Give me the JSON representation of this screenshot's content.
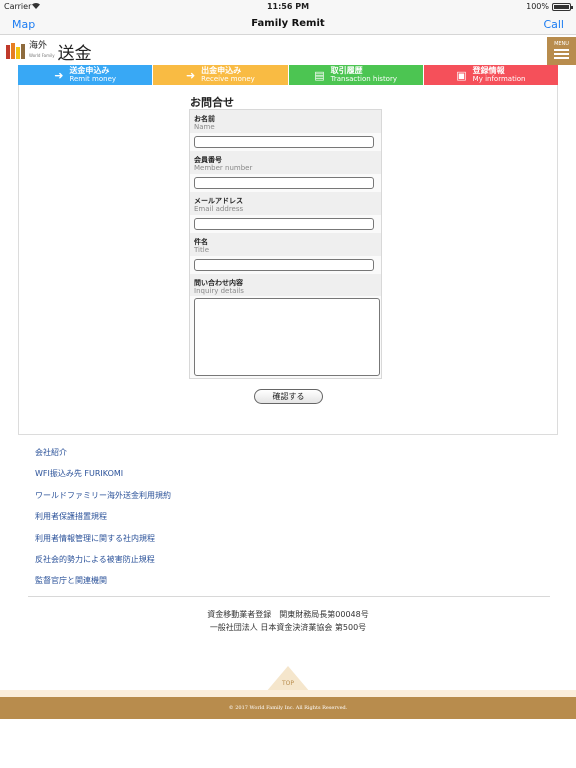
{
  "status_bar": {
    "carrier": "Carrier",
    "time": "11:56 PM",
    "battery": "100%",
    "battery_level": 1.0
  },
  "nav": {
    "left": "Map",
    "title": "Family Remit",
    "right": "Call"
  },
  "logo": {
    "small_jp": "海外",
    "small_en": "World Family",
    "big": "送金",
    "colors": [
      "#c0392b",
      "#e67e22",
      "#f1c40f",
      "#8e6b3d"
    ]
  },
  "menu_button": {
    "label": "MENU"
  },
  "tabs": [
    {
      "jp": "送金申込み",
      "en": "Remit money",
      "icon": "remit-icon",
      "glyph": "➜",
      "color": "#38a8f5"
    },
    {
      "jp": "出金申込み",
      "en": "Receive money",
      "icon": "receive-icon",
      "glyph": "➜",
      "color": "#f9bb43"
    },
    {
      "jp": "取引履歴",
      "en": "Transaction history",
      "icon": "history-icon",
      "glyph": "▤",
      "color": "#4cc552"
    },
    {
      "jp": "登録情報",
      "en": "My information",
      "icon": "id-card-icon",
      "glyph": "▣",
      "color": "#f5505a"
    }
  ],
  "form": {
    "title": "お問合せ",
    "fields": [
      {
        "label_jp": "お名前",
        "label_en": "Name",
        "value": ""
      },
      {
        "label_jp": "会員番号",
        "label_en": "Member number",
        "value": ""
      },
      {
        "label_jp": "メールアドレス",
        "label_en": "Email address",
        "value": ""
      },
      {
        "label_jp": "件名",
        "label_en": "Title",
        "value": ""
      },
      {
        "label_jp": "問い合わせ内容",
        "label_en": "Inquiry details",
        "value": ""
      }
    ],
    "confirm": "確認する"
  },
  "links": [
    "会社紹介",
    "WFI振込み先 FURIKOMI",
    "ワールドファミリー海外送金利用規約",
    "利用者保護措置規程",
    "利用者情報管理に関する社内規程",
    "反社会的勢力による被害防止規程",
    "監督官庁と関連機関"
  ],
  "legal": {
    "line1": "資金移動業者登録　関東財務局長第00048号",
    "line2": "一般社団法人 日本資金決済業協会 第500号"
  },
  "top_button": "TOP",
  "copyright": "© 2017 World Family Inc. All Rights Reserved."
}
